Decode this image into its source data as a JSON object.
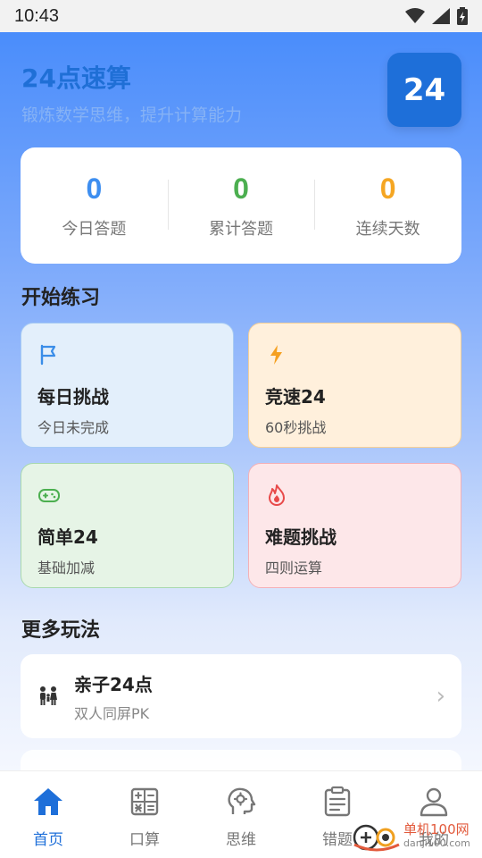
{
  "status_bar": {
    "time": "10:43"
  },
  "header": {
    "title": "24点速算",
    "subtitle": "锻炼数学思维，提升计算能力",
    "badge": "24"
  },
  "stats": [
    {
      "value": "0",
      "label": "今日答题",
      "color": "#3d8ef0"
    },
    {
      "value": "0",
      "label": "累计答题",
      "color": "#4caf50"
    },
    {
      "value": "0",
      "label": "连续天数",
      "color": "#f5a623"
    }
  ],
  "practice": {
    "title": "开始练习",
    "tiles": [
      {
        "title": "每日挑战",
        "sub": "今日未完成",
        "icon": "flag-icon"
      },
      {
        "title": "竞速24",
        "sub": "60秒挑战",
        "icon": "lightning-icon"
      },
      {
        "title": "简单24",
        "sub": "基础加减",
        "icon": "gamepad-icon"
      },
      {
        "title": "难题挑战",
        "sub": "四则运算",
        "icon": "fire-icon"
      }
    ]
  },
  "more": {
    "title": "更多玩法",
    "items": [
      {
        "title": "亲子24点",
        "sub": "双人同屏PK",
        "icon": "family-icon"
      }
    ]
  },
  "nav": [
    {
      "label": "首页",
      "icon": "home-icon",
      "active": true
    },
    {
      "label": "口算",
      "icon": "calculator-icon",
      "active": false
    },
    {
      "label": "思维",
      "icon": "brain-gear-icon",
      "active": false
    },
    {
      "label": "错题",
      "icon": "clipboard-icon",
      "active": false
    },
    {
      "label": "我的",
      "icon": "user-icon",
      "active": false
    }
  ],
  "watermark": {
    "text": "单机100网",
    "url": "danji100.com"
  },
  "colors": {
    "accent": "#1e6fd9",
    "nav_active": "#1e6fd9"
  }
}
